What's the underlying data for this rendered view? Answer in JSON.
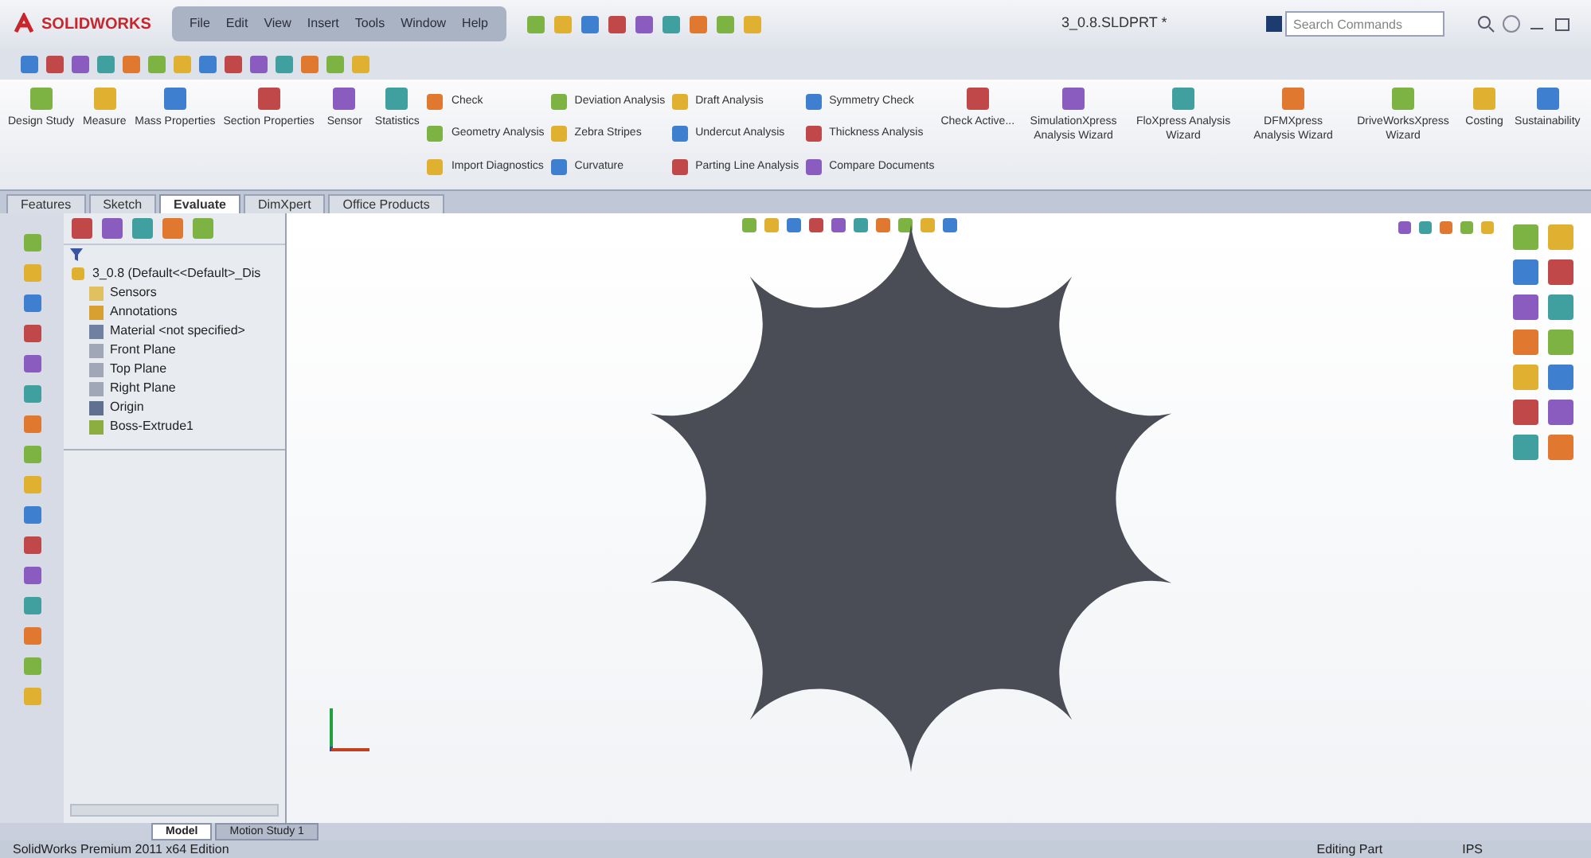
{
  "title_bar": {
    "logo": "SOLIDWORKS",
    "menu": [
      "File",
      "Edit",
      "View",
      "Insert",
      "Tools",
      "Window",
      "Help"
    ],
    "document_title": "3_0.8.SLDPRT *",
    "search": {
      "placeholder": "Search Commands"
    }
  },
  "ribbon": [
    {
      "kind": "large",
      "label": "Design Study"
    },
    {
      "kind": "large",
      "label": "Measure"
    },
    {
      "kind": "large",
      "label": "Mass Properties"
    },
    {
      "kind": "large",
      "label": "Section Properties"
    },
    {
      "kind": "large",
      "label": "Sensor"
    },
    {
      "kind": "large",
      "label": "Statistics"
    },
    {
      "kind": "stack",
      "items": [
        "Check",
        "Geometry Analysis",
        "Import Diagnostics"
      ]
    },
    {
      "kind": "stack",
      "items": [
        "Deviation Analysis",
        "Zebra Stripes",
        "Curvature"
      ]
    },
    {
      "kind": "stack",
      "items": [
        "Draft Analysis",
        "Undercut Analysis",
        "Parting Line Analysis"
      ]
    },
    {
      "kind": "stack",
      "items": [
        "Symmetry Check",
        "Thickness Analysis",
        "Compare Documents"
      ]
    },
    {
      "kind": "large",
      "label": "Check Active..."
    },
    {
      "kind": "large",
      "label": "SimulationXpress Analysis Wizard"
    },
    {
      "kind": "large",
      "label": "FloXpress Analysis Wizard"
    },
    {
      "kind": "large",
      "label": "DFMXpress Analysis Wizard"
    },
    {
      "kind": "large",
      "label": "DriveWorksXpress Wizard"
    },
    {
      "kind": "large",
      "label": "Costing"
    },
    {
      "kind": "large",
      "label": "Sustainability"
    }
  ],
  "tabs": [
    {
      "label": "Features",
      "selected": false
    },
    {
      "label": "Sketch",
      "selected": false
    },
    {
      "label": "Evaluate",
      "selected": true
    },
    {
      "label": "DimXpert",
      "selected": false
    },
    {
      "label": "Office Products",
      "selected": false
    }
  ],
  "feature_tree": {
    "root": "3_0.8 (Default<<Default>_Dis",
    "items": [
      {
        "kind": "folder",
        "label": "Sensors"
      },
      {
        "kind": "annotation",
        "label": "Annotations"
      },
      {
        "kind": "material",
        "label": "Material <not specified>"
      },
      {
        "kind": "plane",
        "label": "Front Plane"
      },
      {
        "kind": "plane",
        "label": "Top Plane"
      },
      {
        "kind": "plane",
        "label": "Right Plane"
      },
      {
        "kind": "origin",
        "label": "Origin"
      },
      {
        "kind": "feature",
        "label": "Boss-Extrude1"
      }
    ]
  },
  "bottom_tabs": [
    {
      "label": "Model",
      "selected": true
    },
    {
      "label": "Motion Study 1",
      "selected": false
    }
  ],
  "status_bar": {
    "product": "SolidWorks Premium 2011 x64 Edition",
    "mode": "Editing Part",
    "units": "IPS"
  }
}
